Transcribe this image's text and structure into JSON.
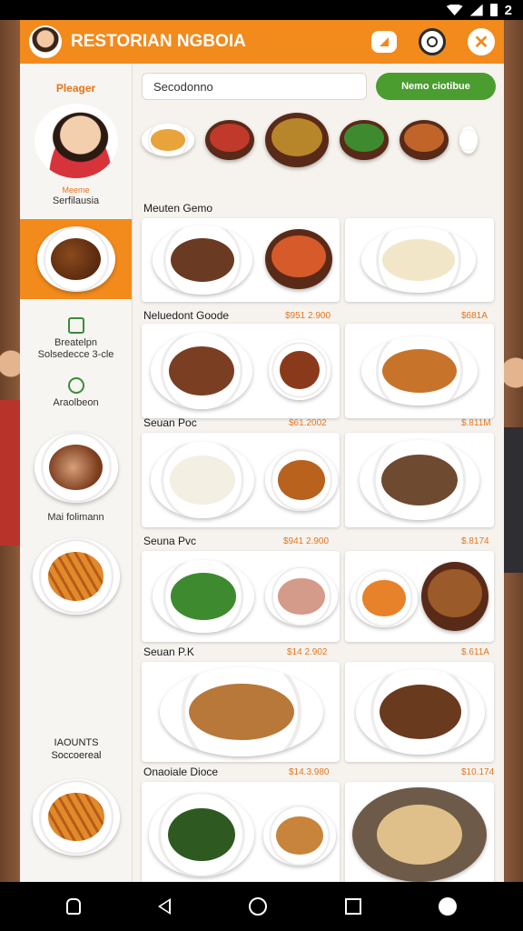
{
  "status_bar": {
    "time_or_count": "2"
  },
  "header": {
    "title": "RESTORIAN NGBOIA"
  },
  "sidebar": {
    "heading": "Pleager",
    "profile_tag": "Meeme",
    "profile_name": "Serfilausia",
    "items": [
      {
        "label_1": "Breatelpn",
        "label_2": "Solsedecce 3-cle"
      },
      {
        "label_1": "Araolbeon",
        "label_2": ""
      }
    ],
    "plate_caption": "Mai folimann",
    "footer_1": "IAOUNTS",
    "footer_2": "Soccoereal"
  },
  "search": {
    "value": "Secodonno",
    "button": "Nemo ciotibue"
  },
  "sections": [
    {
      "title": "Meuten Gemo",
      "price_a": "",
      "price_b": ""
    },
    {
      "title": "Neluedont Goode",
      "price_a": "$951 2.900",
      "price_b": "$681A"
    },
    {
      "title": "Seuan Poc",
      "price_a": "$61.2002",
      "price_b": "$.811M"
    },
    {
      "title": "Seuna Pvc",
      "price_a": "$941 2.900",
      "price_b": "$.8174"
    },
    {
      "title": "Seuan P.K",
      "price_a": "$14 2.902",
      "price_b": "$.611A"
    },
    {
      "title": "Onaoiale Dioce",
      "price_a": "$14.3.980",
      "price_b": "$10.174"
    }
  ],
  "colors": {
    "accent": "#f28a1c",
    "green": "#4a9d2e",
    "panel": "#f6f3ee"
  }
}
